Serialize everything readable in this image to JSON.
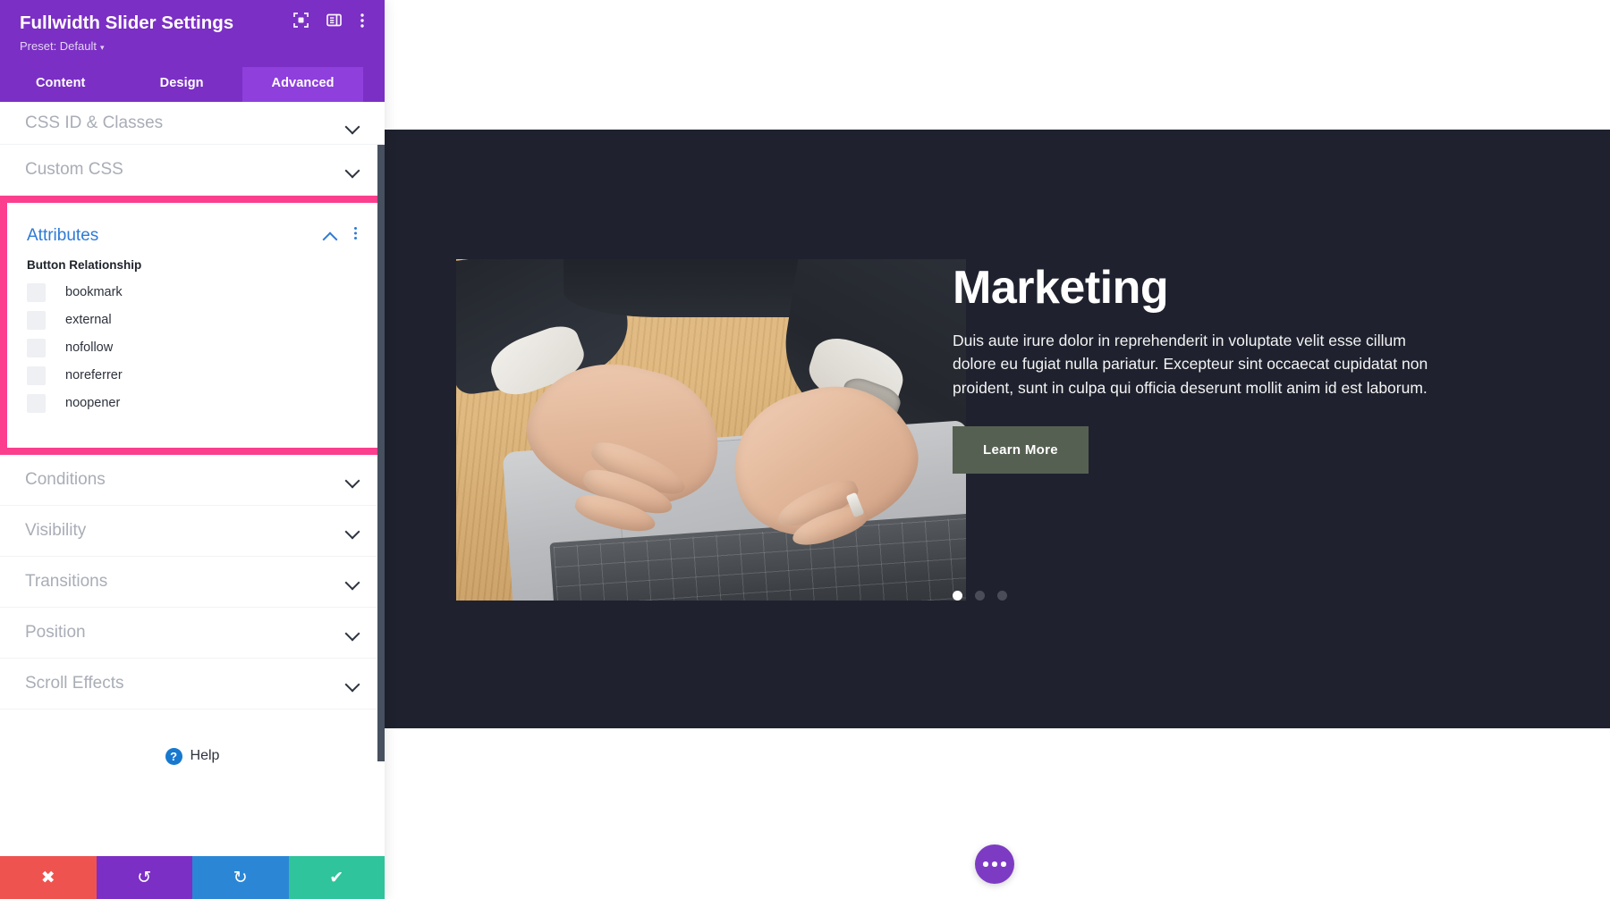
{
  "panel": {
    "title": "Fullwidth Slider Settings",
    "preset_label": "Preset: Default",
    "preset_caret": "▾",
    "header_icons": [
      {
        "name": "focus-frame-icon"
      },
      {
        "name": "panel-layout-icon"
      },
      {
        "name": "kebab-menu-icon"
      }
    ],
    "tabs": [
      {
        "label": "Content",
        "active": false
      },
      {
        "label": "Design",
        "active": false
      },
      {
        "label": "Advanced",
        "active": true
      }
    ],
    "sections_above": [
      {
        "label": "CSS ID & Classes",
        "state": "collapsed"
      },
      {
        "label": "Custom CSS",
        "state": "collapsed"
      }
    ],
    "attributes": {
      "title": "Attributes",
      "state": "expanded",
      "field_label": "Button Relationship",
      "options": [
        {
          "label": "bookmark",
          "checked": false
        },
        {
          "label": "external",
          "checked": false
        },
        {
          "label": "nofollow",
          "checked": false
        },
        {
          "label": "noreferrer",
          "checked": false
        },
        {
          "label": "noopener",
          "checked": false
        }
      ],
      "highlight_color": "#FB3E8D"
    },
    "sections_below": [
      {
        "label": "Conditions",
        "state": "collapsed"
      },
      {
        "label": "Visibility",
        "state": "collapsed"
      },
      {
        "label": "Transitions",
        "state": "collapsed"
      },
      {
        "label": "Position",
        "state": "collapsed"
      },
      {
        "label": "Scroll Effects",
        "state": "collapsed"
      }
    ],
    "help": {
      "badge": "?",
      "label": "Help"
    },
    "actions": [
      {
        "name": "cancel-button",
        "glyph": "✖",
        "color": "#ef5350"
      },
      {
        "name": "undo-button",
        "glyph": "↺",
        "color": "#7B2FC4"
      },
      {
        "name": "redo-button",
        "glyph": "↻",
        "color": "#2B87D6"
      },
      {
        "name": "save-button",
        "glyph": "✔",
        "color": "#2FC49B"
      }
    ]
  },
  "canvas": {
    "slide": {
      "title": "Marketing",
      "body": "Duis aute irure dolor in reprehenderit in voluptate velit esse cillum dolore eu fugiat nulla pariatur. Excepteur sint occaecat cupidatat non proident, sunt in culpa qui officia deserunt mollit anim id est laborum.",
      "button_label": "Learn More",
      "button_color": "#566052",
      "background_color": "#1f222e",
      "image_alt": "hands typing on a laptop on a wooden desk",
      "dots": [
        {
          "active": true
        },
        {
          "active": false
        },
        {
          "active": false
        }
      ]
    },
    "fab": {
      "name": "page-settings-fab",
      "color": "#7d3bc4"
    }
  }
}
